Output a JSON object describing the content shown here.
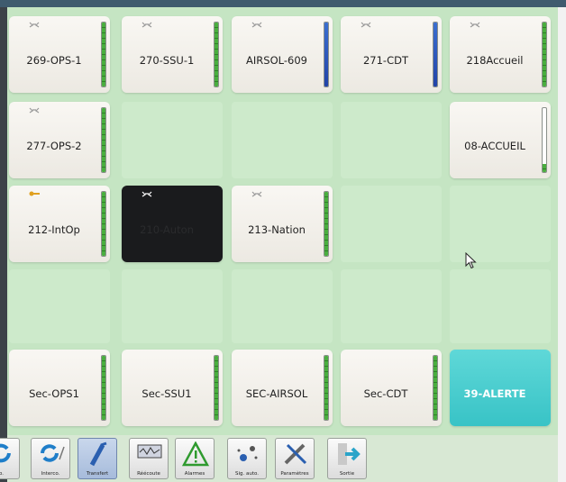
{
  "tiles": [
    {
      "label": "269-OPS-1",
      "icon": "phone-icon",
      "bar": 1.0,
      "style": "normal"
    },
    {
      "label": "270-SSU-1",
      "icon": "phone-icon",
      "bar": 1.0,
      "style": "normal"
    },
    {
      "label": "AIRSOL-609",
      "icon": "phone-icon",
      "bar": 1.0,
      "bar_color": "blue",
      "style": "normal"
    },
    {
      "label": "271-CDT",
      "icon": "phone-icon",
      "bar": 1.0,
      "bar_color": "blue",
      "style": "normal"
    },
    {
      "label": "218Accueil",
      "icon": "phone-icon",
      "bar": 1.0,
      "style": "normal"
    },
    {
      "label": "277-OPS-2",
      "icon": "phone-icon",
      "bar": 1.0,
      "style": "normal"
    },
    {
      "label": "08-ACCUEIL",
      "icon": "",
      "bar": 0.12,
      "style": "normal"
    },
    {
      "label": "212-IntOp",
      "icon": "key-icon",
      "bar": 1.0,
      "style": "normal"
    },
    {
      "label": "210-Auton",
      "icon": "phone-icon",
      "bar": null,
      "style": "dark"
    },
    {
      "label": "213-Nation",
      "icon": "phone-icon",
      "bar": 1.0,
      "style": "normal"
    },
    {
      "label": "Sec-OPS1",
      "icon": "",
      "bar": 1.0,
      "style": "normal"
    },
    {
      "label": "Sec-SSU1",
      "icon": "",
      "bar": 1.0,
      "style": "normal"
    },
    {
      "label": "SEC-AIRSOL",
      "icon": "",
      "bar": 1.0,
      "style": "normal"
    },
    {
      "label": "Sec-CDT",
      "icon": "",
      "bar": 1.0,
      "style": "normal"
    },
    {
      "label": "39-ALERTE",
      "icon": "",
      "bar": null,
      "style": "cyan"
    }
  ],
  "toolbar": [
    {
      "label": "co.",
      "icon": "refresh-icon",
      "active": false
    },
    {
      "label": "Interco.",
      "icon": "interconnect-icon",
      "active": false
    },
    {
      "label": "Transfert",
      "icon": "transfer-icon",
      "active": true
    },
    {
      "label": "Réécoute",
      "icon": "replay-icon",
      "active": false
    },
    {
      "label": "Alarmes",
      "icon": "alarm-icon",
      "active": false
    },
    {
      "label": "Sig. auto.",
      "icon": "signal-icon",
      "active": false
    },
    {
      "label": "Paramètres",
      "icon": "tools-icon",
      "active": false
    },
    {
      "label": "Sortie",
      "icon": "exit-icon",
      "active": false
    }
  ],
  "colors": {
    "green_bar": "#4aae3f",
    "blue_bar": "#2143a8",
    "alert": "#38c3c6",
    "grid_bg": "#c5e5c3"
  }
}
